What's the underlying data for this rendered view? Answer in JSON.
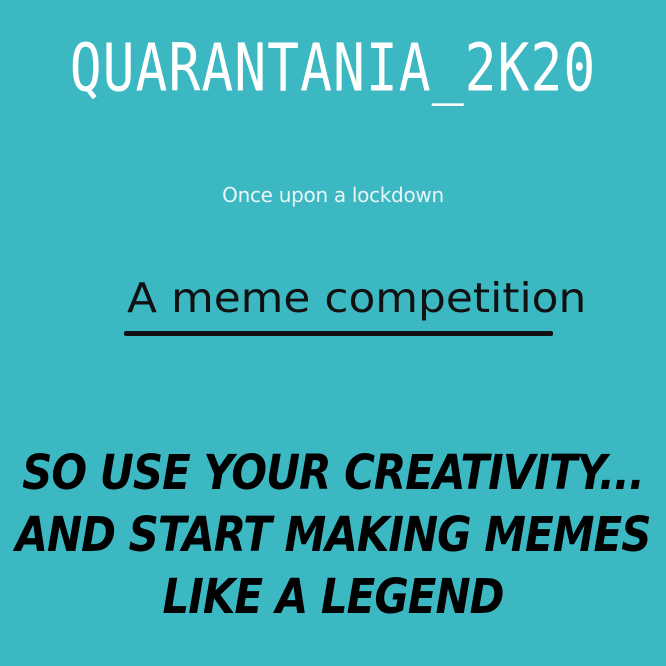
{
  "poster": {
    "title": "QUARANTANIA_2K20",
    "subtitle": "Once upon a lockdown",
    "heading": "A meme competition",
    "message_lines": [
      "SO USE YOUR CREATIVITY...",
      "AND START MAKING MEMES",
      "LIKE A LEGEND"
    ]
  },
  "colors": {
    "background": "#3cb8c3",
    "title": "#ffffff",
    "heading": "#111111",
    "message": "#000000"
  }
}
